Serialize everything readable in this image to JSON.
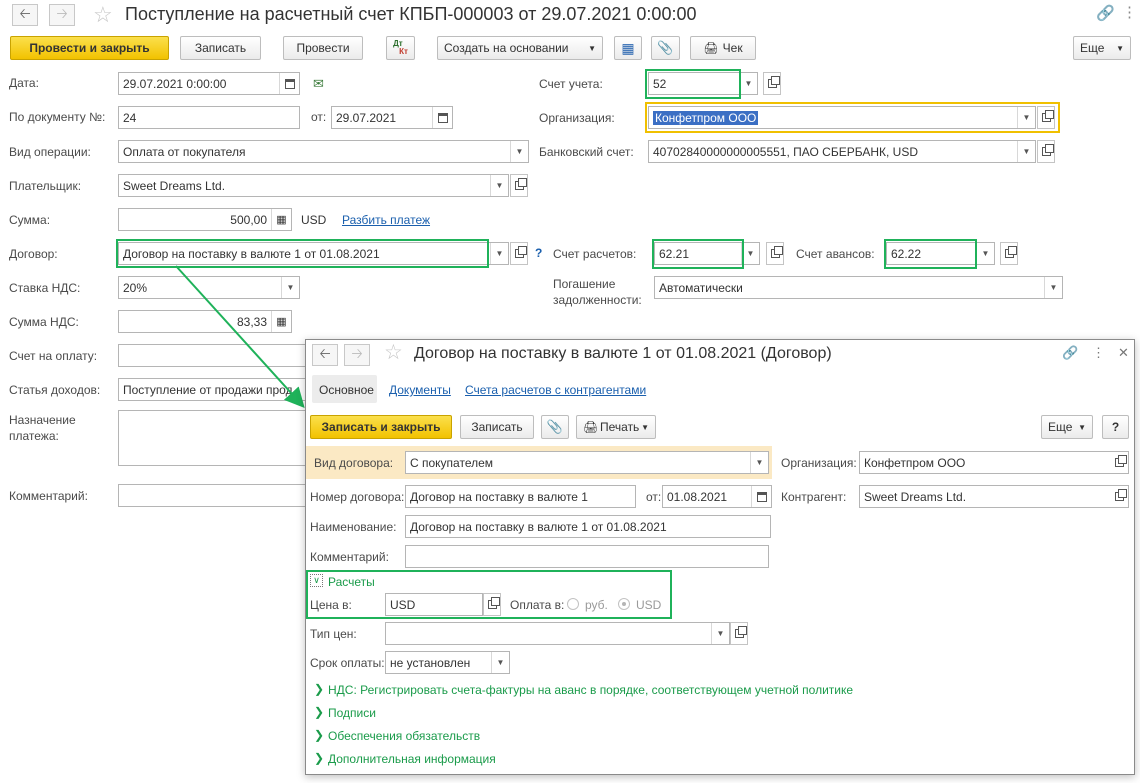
{
  "main": {
    "title": "Поступление на расчетный счет КПБП-000003 от 29.07.2021 0:00:00",
    "toolbar": {
      "post_close": "Провести и закрыть",
      "save": "Записать",
      "post": "Провести",
      "dtkt_top": "Дт",
      "dtkt_bottom": "Кт",
      "create_based": "Создать на основании",
      "check": "Чек",
      "more": "Еще"
    },
    "fields": {
      "date_label": "Дата:",
      "date_value": "29.07.2021  0:00:00",
      "doc_no_label": "По документу №:",
      "doc_no_value": "24",
      "from_label": "от:",
      "from_value": "29.07.2021",
      "operation_label": "Вид операции:",
      "operation_value": "Оплата от покупателя",
      "payer_label": "Плательщик:",
      "payer_value": "Sweet Dreams Ltd.",
      "sum_label": "Сумма:",
      "sum_value": "500,00",
      "currency": "USD",
      "split_link": "Разбить платеж",
      "contract_label": "Договор:",
      "contract_value": "Договор на поставку в валюте 1 от 01.08.2021",
      "help": "?",
      "vat_rate_label": "Ставка НДС:",
      "vat_rate_value": "20%",
      "vat_sum_label": "Сумма НДС:",
      "vat_sum_value": "83,33",
      "invoice_label": "Счет на оплату:",
      "income_label": "Статья доходов:",
      "income_value": "Поступление от продажи прод",
      "purpose_label_1": "Назначение",
      "purpose_label_2": "платежа:",
      "comment_label": "Комментарий:",
      "account_label": "Счет учета:",
      "account_value": "52",
      "org_label": "Организация:",
      "org_value": "Конфетпром ООО",
      "bank_label": "Банковский счет:",
      "bank_value": "40702840000000005551, ПАО СБЕРБАНК, USD",
      "settle_label": "Счет расчетов:",
      "settle_value": "62.21",
      "advance_label": "Счет авансов:",
      "advance_value": "62.22",
      "repay_label_1": "Погашение",
      "repay_label_2": "задолженности:",
      "repay_value": "Автоматически"
    }
  },
  "dialog": {
    "title": "Договор на поставку в валюте 1 от 01.08.2021 (Договор)",
    "tabs": [
      "Основное",
      "Документы",
      "Счета расчетов с контрагентами"
    ],
    "toolbar": {
      "save_close": "Записать и закрыть",
      "save": "Записать",
      "print": "Печать",
      "more": "Еще",
      "help": "?"
    },
    "fields": {
      "kind_label": "Вид договора:",
      "kind_value": "С покупателем",
      "org_label": "Организация:",
      "org_value": "Конфетпром ООО",
      "number_label": "Номер договора:",
      "number_value": "Договор на поставку в валюте 1",
      "from_label": "от:",
      "from_value": "01.08.2021",
      "contractor_label": "Контрагент:",
      "contractor_value": "Sweet Dreams Ltd.",
      "name_label": "Наименование:",
      "name_value": "Договор на поставку в валюте 1 от 01.08.2021",
      "comment_label": "Комментарий:",
      "settlements_header": "Расчеты",
      "price_in_label": "Цена в:",
      "price_in_value": "USD",
      "pay_in_label": "Оплата в:",
      "pay_rub": "руб.",
      "pay_usd": "USD",
      "price_type_label": "Тип цен:",
      "due_label": "Срок оплаты:",
      "due_value": "не установлен"
    },
    "sections": [
      "НДС: Регистрировать счета-фактуры на аванс в порядке, соответствующем учетной политике",
      "Подписи",
      "Обеспечения обязательств",
      "Дополнительная информация"
    ]
  },
  "colors": {
    "highlight_green": "#1fb25a",
    "highlight_yellow": "#f0c000",
    "link_blue": "#1a5fad",
    "section_green": "#1a9b4a",
    "accent_button": "#f2c200"
  }
}
